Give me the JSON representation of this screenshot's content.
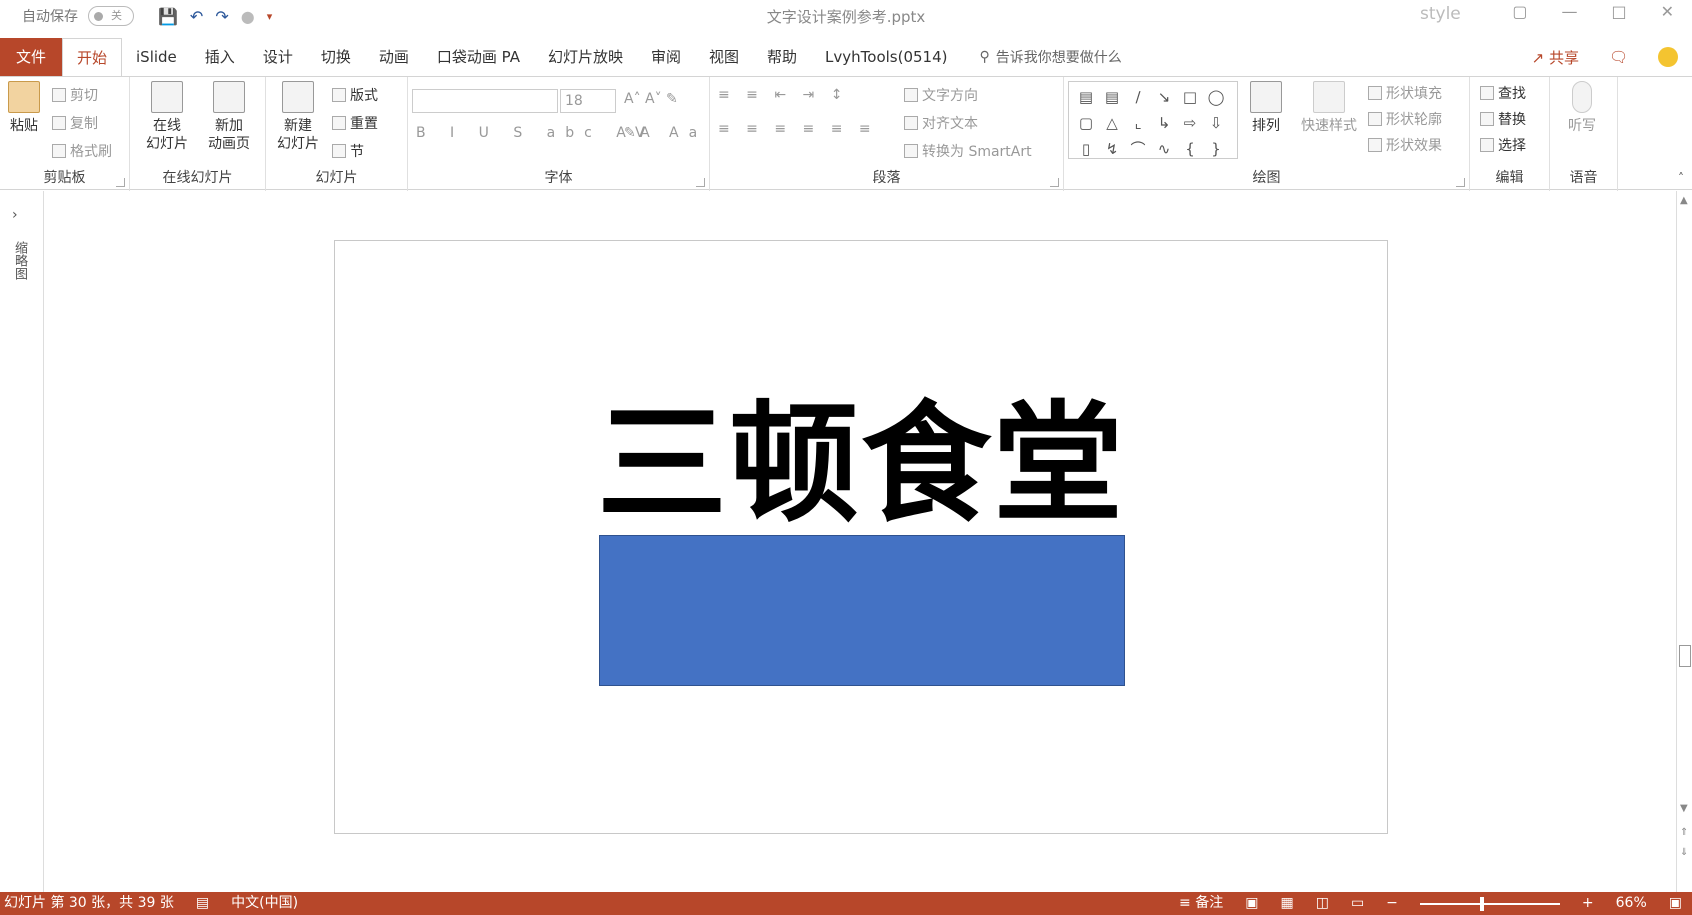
{
  "titlebar": {
    "autosave_label": "自动保存",
    "autosave_state": "关",
    "doc_title": "文字设计案例参考.pptx",
    "style_text": "style"
  },
  "tabs": {
    "file": "文件",
    "items": [
      "开始",
      "iSlide",
      "插入",
      "设计",
      "切换",
      "动画",
      "口袋动画 PA",
      "幻灯片放映",
      "审阅",
      "视图",
      "帮助",
      "LvyhTools(0514)"
    ],
    "tell_me": "告诉我你想要做什么",
    "share": "共享"
  },
  "ribbon": {
    "clipboard": {
      "paste": "粘贴",
      "cut": "剪切",
      "copy": "复制",
      "format_painter": "格式刷",
      "label": "剪贴板"
    },
    "online_slides": {
      "online": "在线",
      "online2": "幻灯片",
      "new_anim": "新加",
      "new_anim2": "动画页",
      "label": "在线幻灯片"
    },
    "slides": {
      "new_slide": "新建",
      "new_slide2": "幻灯片",
      "layout": "版式",
      "reset": "重置",
      "section": "节",
      "label": "幻灯片"
    },
    "font": {
      "font_name": "",
      "font_size": "18",
      "label": "字体",
      "row": "B I U S abc AV Aa"
    },
    "paragraph": {
      "text_direction": "文字方向",
      "align_text": "对齐文本",
      "smartart": "转换为 SmartArt",
      "label": "段落"
    },
    "drawing": {
      "arrange": "排列",
      "quick_styles": "快速样式",
      "fill": "形状填充",
      "outline": "形状轮廓",
      "effects": "形状效果",
      "label": "绘图"
    },
    "editing": {
      "find": "查找",
      "replace": "替换",
      "select": "选择",
      "label": "编辑"
    },
    "voice": {
      "dictate": "听写",
      "label": "语音"
    }
  },
  "workspace": {
    "thumbnails_label": "缩略图",
    "slide_title": "三顿食堂",
    "rect_color": "#4472c4"
  },
  "status": {
    "slide_info": "幻灯片 第 30 张，共 39 张",
    "language": "中文(中国)",
    "notes": "备注",
    "zoom": "66%"
  },
  "colors": {
    "accent": "#b7472a",
    "shape_fill": "#4472c4"
  }
}
